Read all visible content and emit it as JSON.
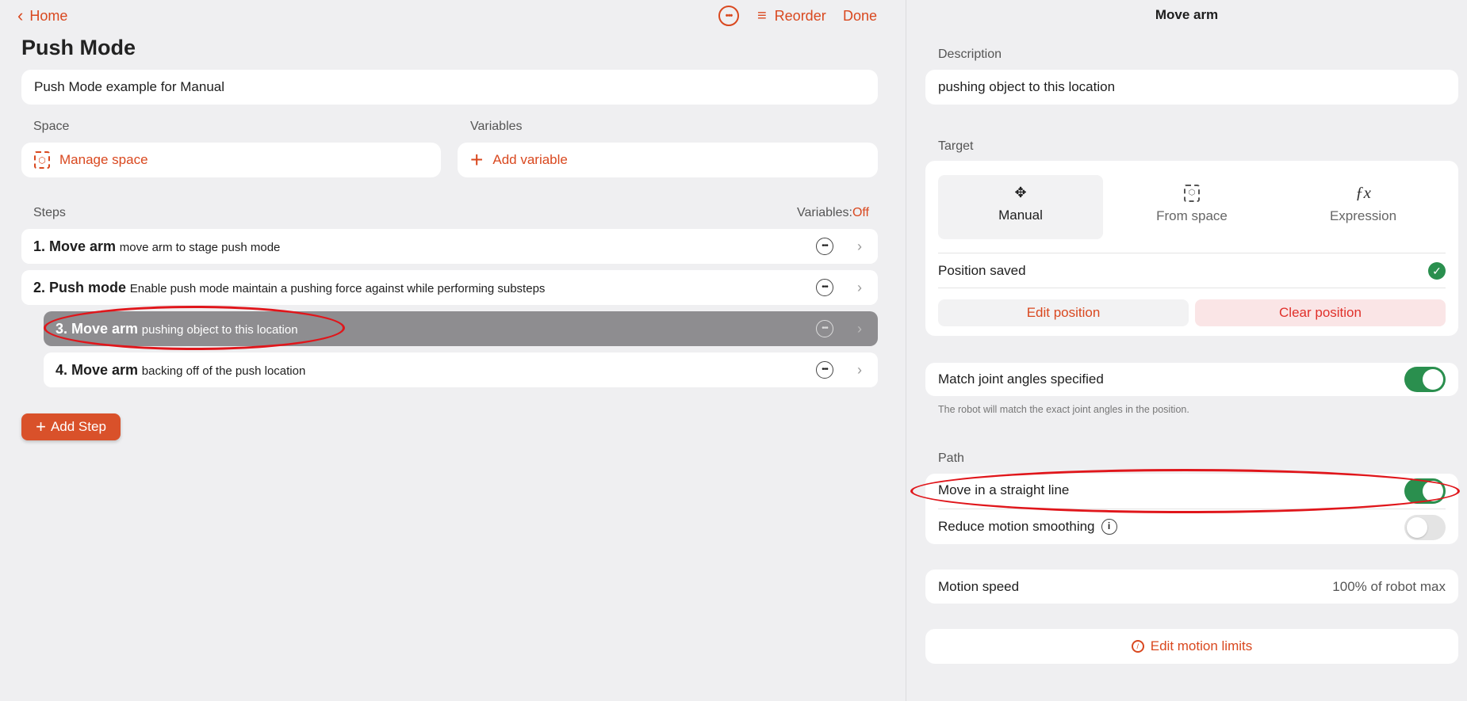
{
  "left": {
    "back_label": "Home",
    "reorder_label": "Reorder",
    "done_label": "Done",
    "title": "Push Mode",
    "description": "Push Mode example for Manual",
    "space_label": "Space",
    "manage_space": "Manage space",
    "variables_label": "Variables",
    "add_variable": "Add variable",
    "steps_label": "Steps",
    "variables_toggle_label": "Variables:",
    "variables_toggle_value": "Off",
    "steps": [
      {
        "title": "1. Move arm",
        "desc": "move arm to stage push mode"
      },
      {
        "title": "2. Push mode",
        "desc": "Enable push mode maintain a pushing force against while performing substeps"
      },
      {
        "title": "3. Move arm",
        "desc": "pushing object to this location",
        "selected": true
      },
      {
        "title": "4. Move arm",
        "desc": "backing off of the push location"
      }
    ],
    "add_step": "Add Step"
  },
  "right": {
    "title": "Move arm",
    "description_label": "Description",
    "description": "pushing object to this location",
    "target_label": "Target",
    "target_options": [
      {
        "label": "Manual",
        "icon": "move-icon",
        "selected": true
      },
      {
        "label": "From space",
        "icon": "cube-frame-icon"
      },
      {
        "label": "Expression",
        "icon": "function-icon"
      }
    ],
    "position_saved": "Position saved",
    "edit_position": "Edit position",
    "clear_position": "Clear position",
    "match_joint": "Match joint angles specified",
    "match_joint_on": true,
    "match_joint_note": "The robot will match the exact joint angles in the position.",
    "path_label": "Path",
    "straight_line": "Move in a straight line",
    "straight_line_on": true,
    "reduce_smoothing": "Reduce motion smoothing",
    "reduce_smoothing_on": false,
    "motion_speed_label": "Motion speed",
    "motion_speed_value": "100% of robot max",
    "edit_motion_limits": "Edit motion limits"
  },
  "colors": {
    "accent": "#d9481f",
    "toggle_on": "#2a8f4e",
    "selected_step": "#8e8d90",
    "annotation": "#e0161b"
  }
}
